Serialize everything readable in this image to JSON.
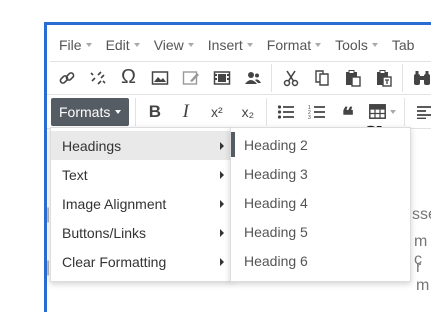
{
  "menubar": {
    "items": [
      {
        "label": "File"
      },
      {
        "label": "Edit"
      },
      {
        "label": "View"
      },
      {
        "label": "Insert"
      },
      {
        "label": "Format"
      },
      {
        "label": "Tools"
      },
      {
        "label": "Tab"
      }
    ]
  },
  "toolbar": {
    "row1_icons": [
      "link-icon",
      "unlink-icon",
      "omega-icon",
      "image-icon",
      "edit-image-icon",
      "media-icon",
      "users-icon",
      "cut-icon",
      "copy-icon",
      "paste-icon",
      "paste-text-icon",
      "binoculars-icon"
    ],
    "formats_label": "Formats",
    "bold_glyph": "B",
    "italic_glyph": "I",
    "superscript_glyph": "x²",
    "subscript_glyph": "x₂",
    "quote_glyph": "❝"
  },
  "content": {
    "heading_fragment": "g",
    "lines": [
      "sse",
      "m c",
      "r m"
    ]
  },
  "formats_menu": {
    "items": [
      {
        "label": "Headings",
        "active": true
      },
      {
        "label": "Text"
      },
      {
        "label": "Image Alignment"
      },
      {
        "label": "Buttons/Links"
      },
      {
        "label": "Clear Formatting"
      }
    ]
  },
  "headings_submenu": {
    "items": [
      {
        "label": "Heading 2",
        "active": true
      },
      {
        "label": "Heading 3"
      },
      {
        "label": "Heading 4"
      },
      {
        "label": "Heading 5"
      },
      {
        "label": "Heading 6"
      }
    ]
  },
  "colors": {
    "frame_border": "#2b6cd4",
    "formats_button_bg": "#555c63",
    "menu_active_bg": "#e9e9e9"
  }
}
